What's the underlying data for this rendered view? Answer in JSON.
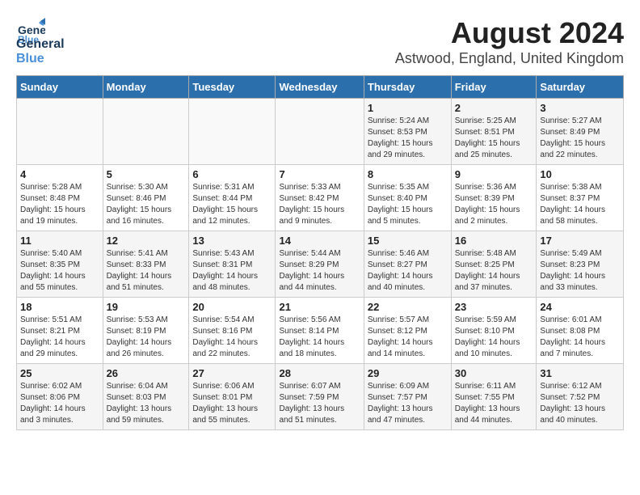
{
  "header": {
    "logo_general": "General",
    "logo_blue": "Blue",
    "title": "August 2024",
    "subtitle": "Astwood, England, United Kingdom"
  },
  "days_of_week": [
    "Sunday",
    "Monday",
    "Tuesday",
    "Wednesday",
    "Thursday",
    "Friday",
    "Saturday"
  ],
  "weeks": [
    [
      {
        "day": "",
        "info": ""
      },
      {
        "day": "",
        "info": ""
      },
      {
        "day": "",
        "info": ""
      },
      {
        "day": "",
        "info": ""
      },
      {
        "day": "1",
        "info": "Sunrise: 5:24 AM\nSunset: 8:53 PM\nDaylight: 15 hours\nand 29 minutes."
      },
      {
        "day": "2",
        "info": "Sunrise: 5:25 AM\nSunset: 8:51 PM\nDaylight: 15 hours\nand 25 minutes."
      },
      {
        "day": "3",
        "info": "Sunrise: 5:27 AM\nSunset: 8:49 PM\nDaylight: 15 hours\nand 22 minutes."
      }
    ],
    [
      {
        "day": "4",
        "info": "Sunrise: 5:28 AM\nSunset: 8:48 PM\nDaylight: 15 hours\nand 19 minutes."
      },
      {
        "day": "5",
        "info": "Sunrise: 5:30 AM\nSunset: 8:46 PM\nDaylight: 15 hours\nand 16 minutes."
      },
      {
        "day": "6",
        "info": "Sunrise: 5:31 AM\nSunset: 8:44 PM\nDaylight: 15 hours\nand 12 minutes."
      },
      {
        "day": "7",
        "info": "Sunrise: 5:33 AM\nSunset: 8:42 PM\nDaylight: 15 hours\nand 9 minutes."
      },
      {
        "day": "8",
        "info": "Sunrise: 5:35 AM\nSunset: 8:40 PM\nDaylight: 15 hours\nand 5 minutes."
      },
      {
        "day": "9",
        "info": "Sunrise: 5:36 AM\nSunset: 8:39 PM\nDaylight: 15 hours\nand 2 minutes."
      },
      {
        "day": "10",
        "info": "Sunrise: 5:38 AM\nSunset: 8:37 PM\nDaylight: 14 hours\nand 58 minutes."
      }
    ],
    [
      {
        "day": "11",
        "info": "Sunrise: 5:40 AM\nSunset: 8:35 PM\nDaylight: 14 hours\nand 55 minutes."
      },
      {
        "day": "12",
        "info": "Sunrise: 5:41 AM\nSunset: 8:33 PM\nDaylight: 14 hours\nand 51 minutes."
      },
      {
        "day": "13",
        "info": "Sunrise: 5:43 AM\nSunset: 8:31 PM\nDaylight: 14 hours\nand 48 minutes."
      },
      {
        "day": "14",
        "info": "Sunrise: 5:44 AM\nSunset: 8:29 PM\nDaylight: 14 hours\nand 44 minutes."
      },
      {
        "day": "15",
        "info": "Sunrise: 5:46 AM\nSunset: 8:27 PM\nDaylight: 14 hours\nand 40 minutes."
      },
      {
        "day": "16",
        "info": "Sunrise: 5:48 AM\nSunset: 8:25 PM\nDaylight: 14 hours\nand 37 minutes."
      },
      {
        "day": "17",
        "info": "Sunrise: 5:49 AM\nSunset: 8:23 PM\nDaylight: 14 hours\nand 33 minutes."
      }
    ],
    [
      {
        "day": "18",
        "info": "Sunrise: 5:51 AM\nSunset: 8:21 PM\nDaylight: 14 hours\nand 29 minutes."
      },
      {
        "day": "19",
        "info": "Sunrise: 5:53 AM\nSunset: 8:19 PM\nDaylight: 14 hours\nand 26 minutes."
      },
      {
        "day": "20",
        "info": "Sunrise: 5:54 AM\nSunset: 8:16 PM\nDaylight: 14 hours\nand 22 minutes."
      },
      {
        "day": "21",
        "info": "Sunrise: 5:56 AM\nSunset: 8:14 PM\nDaylight: 14 hours\nand 18 minutes."
      },
      {
        "day": "22",
        "info": "Sunrise: 5:57 AM\nSunset: 8:12 PM\nDaylight: 14 hours\nand 14 minutes."
      },
      {
        "day": "23",
        "info": "Sunrise: 5:59 AM\nSunset: 8:10 PM\nDaylight: 14 hours\nand 10 minutes."
      },
      {
        "day": "24",
        "info": "Sunrise: 6:01 AM\nSunset: 8:08 PM\nDaylight: 14 hours\nand 7 minutes."
      }
    ],
    [
      {
        "day": "25",
        "info": "Sunrise: 6:02 AM\nSunset: 8:06 PM\nDaylight: 14 hours\nand 3 minutes."
      },
      {
        "day": "26",
        "info": "Sunrise: 6:04 AM\nSunset: 8:03 PM\nDaylight: 13 hours\nand 59 minutes."
      },
      {
        "day": "27",
        "info": "Sunrise: 6:06 AM\nSunset: 8:01 PM\nDaylight: 13 hours\nand 55 minutes."
      },
      {
        "day": "28",
        "info": "Sunrise: 6:07 AM\nSunset: 7:59 PM\nDaylight: 13 hours\nand 51 minutes."
      },
      {
        "day": "29",
        "info": "Sunrise: 6:09 AM\nSunset: 7:57 PM\nDaylight: 13 hours\nand 47 minutes."
      },
      {
        "day": "30",
        "info": "Sunrise: 6:11 AM\nSunset: 7:55 PM\nDaylight: 13 hours\nand 44 minutes."
      },
      {
        "day": "31",
        "info": "Sunrise: 6:12 AM\nSunset: 7:52 PM\nDaylight: 13 hours\nand 40 minutes."
      }
    ]
  ]
}
